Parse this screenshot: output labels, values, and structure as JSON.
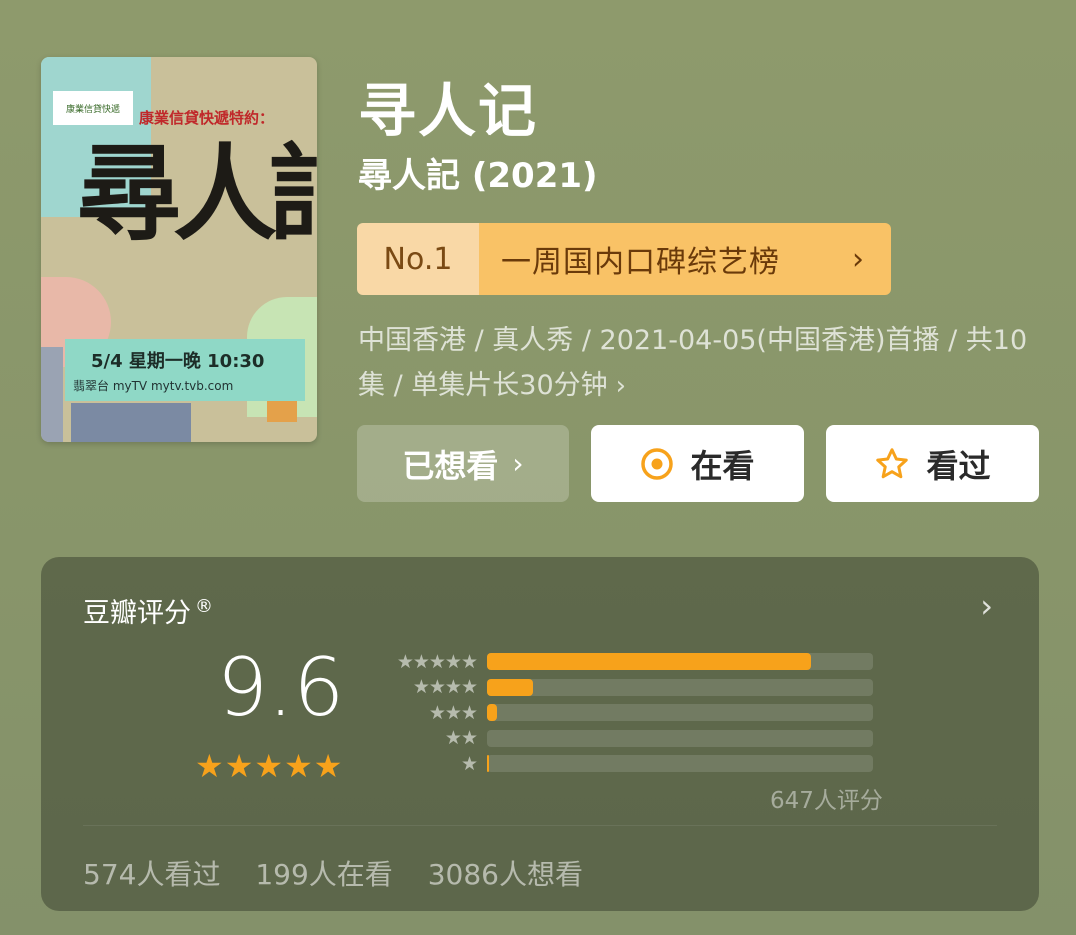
{
  "poster": {
    "sponsor": "康業信貸快遞特約：",
    "logo_text": "康業信貸快遞",
    "title": "尋人記",
    "airtime": "5/4  星期一晚 10:30",
    "channels": "翡翠台  myTV  mytv.tvb.com"
  },
  "title": "寻人记",
  "original_title": "尋人記 (2021)",
  "ranking": {
    "number": "No.1",
    "label": "一周国内口碑综艺榜",
    "chevron": "›"
  },
  "meta": "中国香港 / 真人秀 / 2021-04-05(中国香港)首播 / 共10集 / 单集片长30分钟",
  "meta_chevron": "›",
  "buttons": {
    "want": "已想看",
    "want_chevron": "›",
    "watching": "在看",
    "watched": "看过"
  },
  "rating": {
    "label": "豆瓣评分",
    "registered_mark": "®",
    "arrow": "›",
    "score": "9.6",
    "stars": "★★★★★",
    "distribution": [
      {
        "stars": "★★★★★",
        "fraction": 0.84
      },
      {
        "stars": "★★★★",
        "fraction": 0.12
      },
      {
        "stars": "★★★",
        "fraction": 0.025
      },
      {
        "stars": "★★",
        "fraction": 0.0
      },
      {
        "stars": "★",
        "fraction": 0.005
      }
    ],
    "count": "647人评分"
  },
  "stats": {
    "watched": "574人看过",
    "watching": "199人在看",
    "wish": "3086人想看"
  },
  "colors": {
    "accent": "#f7a21b",
    "rank_no_bg": "#f9d8a6",
    "rank_text_bg": "#f9c266"
  }
}
